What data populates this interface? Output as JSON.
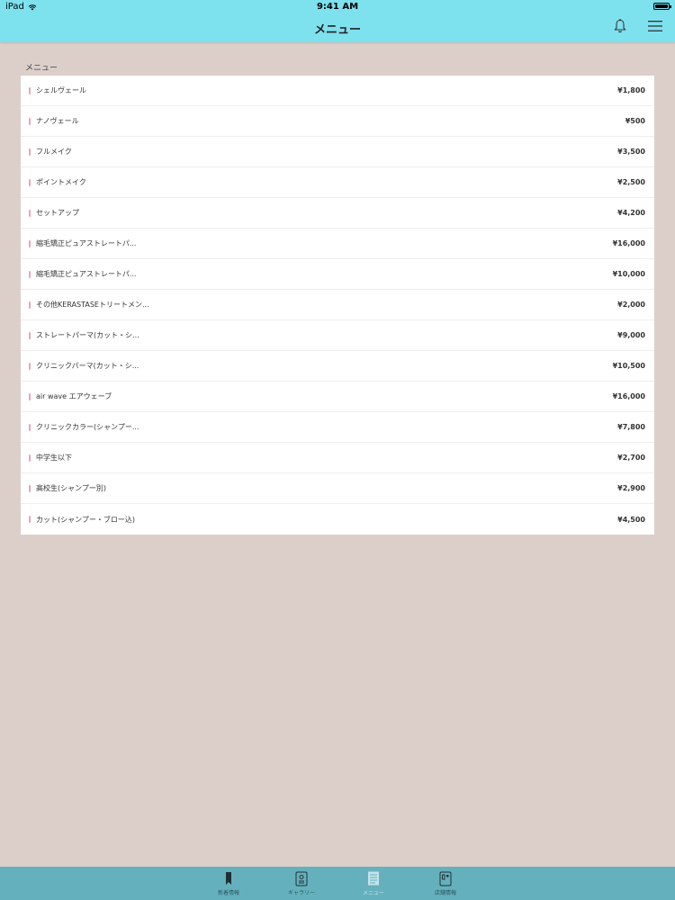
{
  "status_bar": {
    "device": "iPad",
    "time": "9:41 AM"
  },
  "nav": {
    "title": "メニュー",
    "icons": [
      "bell-icon",
      "hamburger-icon"
    ]
  },
  "section_title": "メニュー",
  "menu_items": [
    {
      "name": "シェルヴェール",
      "price": "¥1,800"
    },
    {
      "name": "ナノヴェール",
      "price": "¥500"
    },
    {
      "name": "フルメイク",
      "price": "¥3,500"
    },
    {
      "name": "ポイントメイク",
      "price": "¥2,500"
    },
    {
      "name": "セットアップ",
      "price": "¥4,200"
    },
    {
      "name": "縮毛矯正ピュアストレートパ...",
      "price": "¥16,000"
    },
    {
      "name": "縮毛矯正ピュアストレートパ...",
      "price": "¥10,000"
    },
    {
      "name": "その他KERASTASEトリートメン...",
      "price": "¥2,000"
    },
    {
      "name": "ストレートパーマ(カット・シ...",
      "price": "¥9,000"
    },
    {
      "name": "クリニックパーマ(カット・シ...",
      "price": "¥10,500"
    },
    {
      "name": "air wave エアウェーブ",
      "price": "¥16,000"
    },
    {
      "name": "クリニックカラー(シャンプー...",
      "price": "¥7,800"
    },
    {
      "name": "中学生以下",
      "price": "¥2,700"
    },
    {
      "name": "高校生(シャンプー別)",
      "price": "¥2,900"
    },
    {
      "name": "カット(シャンプー・ブロー込)",
      "price": "¥4,500"
    }
  ],
  "tabs": [
    {
      "label": "新着情報",
      "icon": "bookmark-icon",
      "active": false
    },
    {
      "label": "ギャラリー",
      "icon": "gallery-icon",
      "active": false
    },
    {
      "label": "メニュー",
      "icon": "document-icon",
      "active": true
    },
    {
      "label": "店舗情報",
      "icon": "shop-info-icon",
      "active": false
    }
  ],
  "colors": {
    "nav_bg": "#7ee1ee",
    "page_bg": "#dccfca",
    "tab_bg": "#64b1bd",
    "row_marker": "#e8a6b5"
  }
}
